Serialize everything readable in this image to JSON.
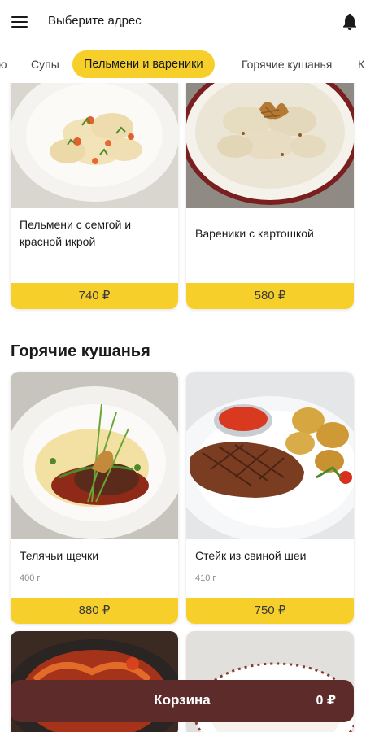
{
  "header": {
    "address_label": "Выберите адрес",
    "menu_icon": "menu-icon",
    "notification_icon": "bell-icon"
  },
  "tabs": [
    {
      "label": "ю"
    },
    {
      "label": "Супы"
    },
    {
      "label": "Пельмени и вареники",
      "active": true
    },
    {
      "label": "Горячие кушанья"
    },
    {
      "label": "К"
    }
  ],
  "sections": [
    {
      "title": "",
      "items": [
        {
          "name": "Пельмени с семгой и красной икрой",
          "weight": "",
          "price": "740 ₽"
        },
        {
          "name": "Вареники с картошкой",
          "weight": "",
          "price": "580 ₽"
        }
      ]
    },
    {
      "title": "Горячие кушанья",
      "items": [
        {
          "name": "Телячьи щечки",
          "weight": "400 г",
          "price": "880 ₽"
        },
        {
          "name": "Стейк  из свиной шеи",
          "weight": "410 г",
          "price": "750 ₽"
        }
      ]
    }
  ],
  "cart": {
    "label": "Корзина",
    "total": "0 ₽"
  },
  "colors": {
    "accent": "#f7cf2a",
    "cart_bg": "#5e2b2b"
  }
}
